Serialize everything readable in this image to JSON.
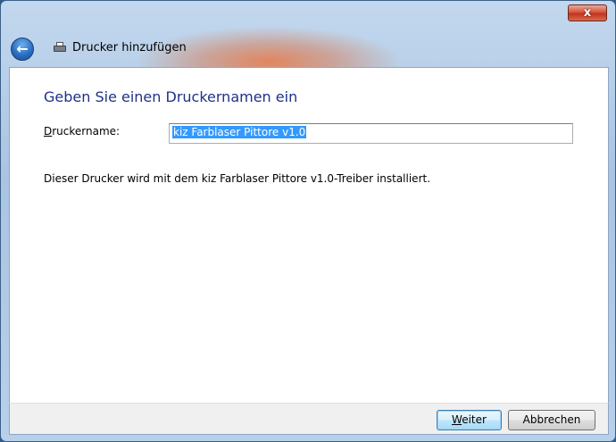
{
  "window": {
    "title": "Drucker hinzufügen",
    "close_label": "x"
  },
  "nav": {
    "back_glyph": "←"
  },
  "page": {
    "heading": "Geben Sie einen Druckernamen ein",
    "field_label_accel": "D",
    "field_label_rest": "ruckername:",
    "printer_name_value": "kiz Farblaser Pittore v1.0",
    "info_text": "Dieser Drucker wird mit dem kiz Farblaser Pittore v1.0-Treiber installiert."
  },
  "buttons": {
    "next_accel": "W",
    "next_rest": "eiter",
    "cancel": "Abbrechen"
  },
  "icons": {
    "back": "back-arrow-icon",
    "printer": "printer-icon",
    "close": "close-icon"
  },
  "colors": {
    "heading": "#1e3287",
    "selection": "#3399ff",
    "close_button": "#c1341c"
  }
}
